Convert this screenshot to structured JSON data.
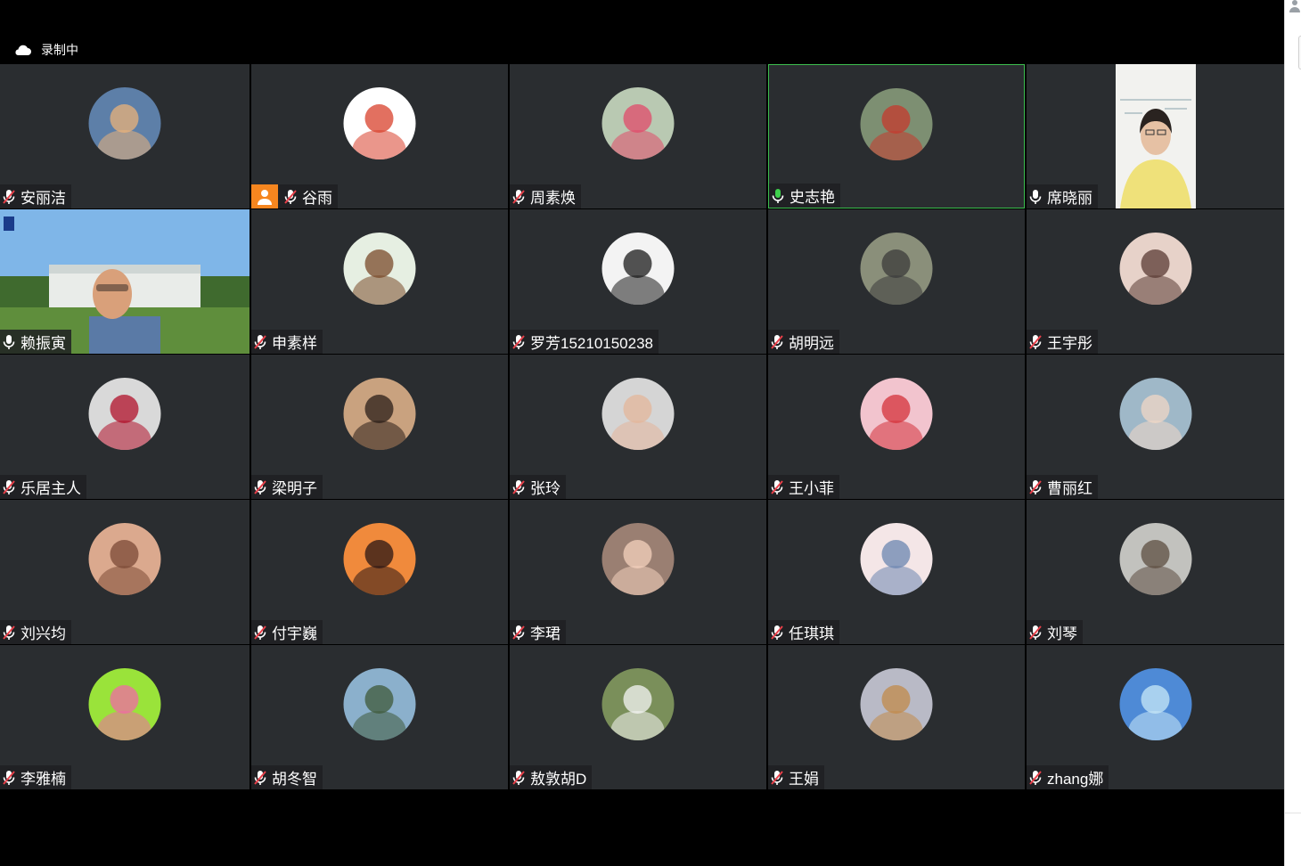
{
  "recording": {
    "label": "录制中",
    "icon": "cloud-icon"
  },
  "participants": [
    {
      "name": "安丽洁",
      "mic": "muted",
      "avatar_bg": "#5d7fa8",
      "avatar_fg": "#e9b27a"
    },
    {
      "name": "谷雨",
      "mic": "muted",
      "host": true,
      "avatar_bg": "#ffffff",
      "avatar_fg": "#d8402b"
    },
    {
      "name": "周素焕",
      "mic": "muted",
      "avatar_bg": "#b9c9b2",
      "avatar_fg": "#e24a6a"
    },
    {
      "name": "史志艳",
      "mic": "active",
      "active_speaker": true,
      "avatar_bg": "#7d8f72",
      "avatar_fg": "#c63a2e"
    },
    {
      "name": "席晓丽",
      "mic": "on",
      "video": true
    },
    {
      "name": "赖振寅",
      "mic": "on",
      "video": true
    },
    {
      "name": "申素样",
      "mic": "muted",
      "avatar_bg": "#e6efe2",
      "avatar_fg": "#7a4a2a"
    },
    {
      "name": "罗芳15210150238",
      "mic": "muted",
      "avatar_bg": "#f3f3f3",
      "avatar_fg": "#1b1b1b"
    },
    {
      "name": "胡明远",
      "mic": "muted",
      "avatar_bg": "#8a8f7a",
      "avatar_fg": "#3b3b3b"
    },
    {
      "name": "王宇彤",
      "mic": "muted",
      "avatar_bg": "#e7d2c9",
      "avatar_fg": "#5a3a33"
    },
    {
      "name": "乐居主人",
      "mic": "muted",
      "avatar_bg": "#d9d9d9",
      "avatar_fg": "#b0102a"
    },
    {
      "name": "梁明子",
      "mic": "muted",
      "avatar_bg": "#c9a27f",
      "avatar_fg": "#2a1e18"
    },
    {
      "name": "张玲",
      "mic": "muted",
      "avatar_bg": "#d5d5d5",
      "avatar_fg": "#e3b59a"
    },
    {
      "name": "王小菲",
      "mic": "muted",
      "avatar_bg": "#f2c4ce",
      "avatar_fg": "#d4323a"
    },
    {
      "name": "曹丽红",
      "mic": "muted",
      "avatar_bg": "#9fb8c8",
      "avatar_fg": "#f0d7c6"
    },
    {
      "name": "刘兴均",
      "mic": "muted",
      "avatar_bg": "#dba98e",
      "avatar_fg": "#7b4a35"
    },
    {
      "name": "付宇巍",
      "mic": "muted",
      "avatar_bg": "#f08a3c",
      "avatar_fg": "#2a1614"
    },
    {
      "name": "李珺",
      "mic": "muted",
      "avatar_bg": "#9a7f72",
      "avatar_fg": "#f4d2bd"
    },
    {
      "name": "任琪琪",
      "mic": "muted",
      "avatar_bg": "#f4e6e7",
      "avatar_fg": "#6b85b0"
    },
    {
      "name": "刘琴",
      "mic": "muted",
      "avatar_bg": "#c2c2be",
      "avatar_fg": "#5c4d40"
    },
    {
      "name": "李雅楠",
      "mic": "muted",
      "avatar_bg": "#9ae33a",
      "avatar_fg": "#f06aa6"
    },
    {
      "name": "胡冬智",
      "mic": "muted",
      "avatar_bg": "#8bb0cc",
      "avatar_fg": "#3f5a3a"
    },
    {
      "name": "敖敦胡D",
      "mic": "muted",
      "avatar_bg": "#7a8f5a",
      "avatar_fg": "#f5f5f5"
    },
    {
      "name": "王娟",
      "mic": "muted",
      "avatar_bg": "#b9bac6",
      "avatar_fg": "#c28a4a"
    },
    {
      "name": "zhang娜",
      "mic": "muted",
      "avatar_bg": "#4e8ad6",
      "avatar_fg": "#c8e8f7"
    }
  ]
}
